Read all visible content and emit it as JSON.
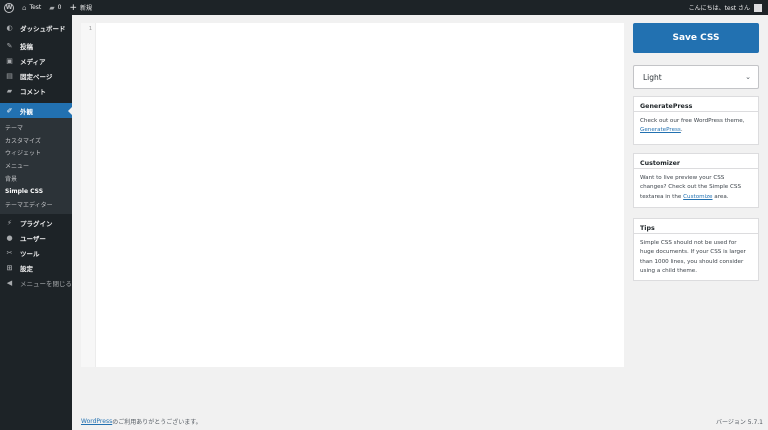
{
  "adminbar": {
    "wp_icon": "wordpress-logo-icon",
    "site_name": "Test",
    "comments_count": "0",
    "new_label": "新規",
    "greeting": "こんにちは、test さん"
  },
  "sidebar": {
    "items": [
      {
        "label": "ダッシュボード",
        "icon": "dashboard-icon"
      },
      {
        "label": "投稿",
        "icon": "pin-icon"
      },
      {
        "label": "メディア",
        "icon": "media-icon"
      },
      {
        "label": "固定ページ",
        "icon": "page-icon"
      },
      {
        "label": "コメント",
        "icon": "comment-icon"
      },
      {
        "label": "外観",
        "icon": "brush-icon"
      }
    ],
    "submenu": [
      "テーマ",
      "カスタマイズ",
      "ウィジェット",
      "メニュー",
      "背景",
      "Simple CSS",
      "テーマエディター"
    ],
    "items_after": [
      {
        "label": "プラグイン",
        "icon": "plugin-icon"
      },
      {
        "label": "ユーザー",
        "icon": "user-icon"
      },
      {
        "label": "ツール",
        "icon": "wrench-icon"
      },
      {
        "label": "設定",
        "icon": "settings-icon"
      },
      {
        "label": "メニューを閉じる",
        "icon": "collapse-icon"
      }
    ]
  },
  "editor": {
    "line_number": "1"
  },
  "save_label": "Save CSS",
  "theme_select": {
    "selected": "Light"
  },
  "boxes": {
    "generatepress": {
      "title": "GeneratePress",
      "text": "Check out our free WordPress theme,",
      "link": "GeneratePress",
      "suffix": "."
    },
    "customizer": {
      "title": "Customizer",
      "text": "Want to live preview your CSS changes? Check out the Simple CSS textarea in the",
      "link": "Customize",
      "suffix": " area."
    },
    "tips": {
      "title": "Tips",
      "text": "Simple CSS should not be used for huge documents. If your CSS is larger than 1000 lines, you should consider using a child theme."
    }
  },
  "footer": {
    "link": "WordPress",
    "thanks": " のご利用ありがとうございます。",
    "version": "バージョン 5.7.1"
  }
}
